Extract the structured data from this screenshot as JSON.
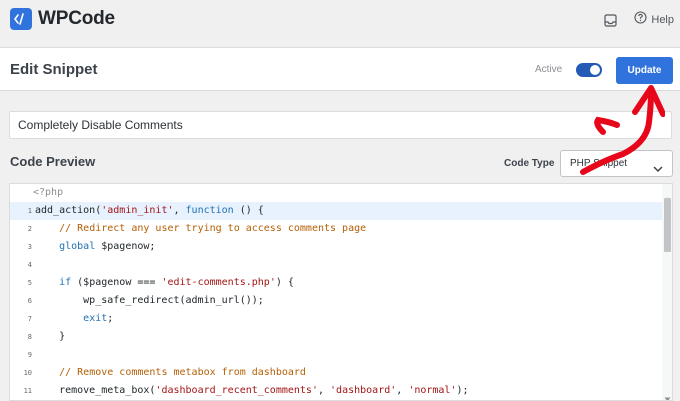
{
  "app": {
    "brand": "WPCode",
    "help_label": "Help"
  },
  "header": {
    "title": "Edit Snippet",
    "active_label": "Active",
    "active": true,
    "update_label": "Update"
  },
  "snippet": {
    "title_value": "Completely Disable Comments"
  },
  "code_preview": {
    "heading": "Code Preview",
    "code_type_label": "Code Type",
    "code_type_value": "PHP Snippet",
    "open_tag": "<?php",
    "lines": [
      {
        "num": "1",
        "tokens": [
          [
            "f",
            "add_action("
          ],
          [
            "s",
            "'admin_init'"
          ],
          [
            "f",
            ", "
          ],
          [
            "k",
            "function"
          ],
          [
            "f",
            " () {"
          ]
        ]
      },
      {
        "num": "2",
        "tokens": [
          [
            "f",
            "    "
          ],
          [
            "c",
            "// Redirect any user trying to access comments page"
          ]
        ]
      },
      {
        "num": "3",
        "tokens": [
          [
            "f",
            "    "
          ],
          [
            "k",
            "global"
          ],
          [
            "f",
            " $pagenow;"
          ]
        ]
      },
      {
        "num": "4",
        "tokens": [
          [
            "f",
            ""
          ]
        ]
      },
      {
        "num": "5",
        "tokens": [
          [
            "f",
            "    "
          ],
          [
            "k",
            "if"
          ],
          [
            "f",
            " ($pagenow === "
          ],
          [
            "s",
            "'edit-comments.php'"
          ],
          [
            "f",
            ") {"
          ]
        ]
      },
      {
        "num": "6",
        "tokens": [
          [
            "f",
            "        wp_safe_redirect(admin_url());"
          ]
        ]
      },
      {
        "num": "7",
        "tokens": [
          [
            "f",
            "        "
          ],
          [
            "k",
            "exit"
          ],
          [
            "f",
            ";"
          ]
        ]
      },
      {
        "num": "8",
        "tokens": [
          [
            "f",
            "    }"
          ]
        ]
      },
      {
        "num": "9",
        "tokens": [
          [
            "f",
            ""
          ]
        ]
      },
      {
        "num": "10",
        "tokens": [
          [
            "f",
            "    "
          ],
          [
            "c",
            "// Remove comments metabox from dashboard"
          ]
        ]
      },
      {
        "num": "11",
        "tokens": [
          [
            "f",
            "    remove_meta_box("
          ],
          [
            "s",
            "'dashboard_recent_comments'"
          ],
          [
            "f",
            ", "
          ],
          [
            "s",
            "'dashboard'"
          ],
          [
            "f",
            ", "
          ],
          [
            "s",
            "'normal'"
          ],
          [
            "f",
            ");"
          ]
        ]
      }
    ]
  },
  "colors": {
    "accent": "#3173dc",
    "toggle": "#2459b5",
    "annotation": "#e8071a"
  },
  "icons": {
    "logo": "code-brackets-icon",
    "inbox": "inbox-icon",
    "help": "help-circle-icon",
    "chevron": "chevron-down-icon"
  }
}
